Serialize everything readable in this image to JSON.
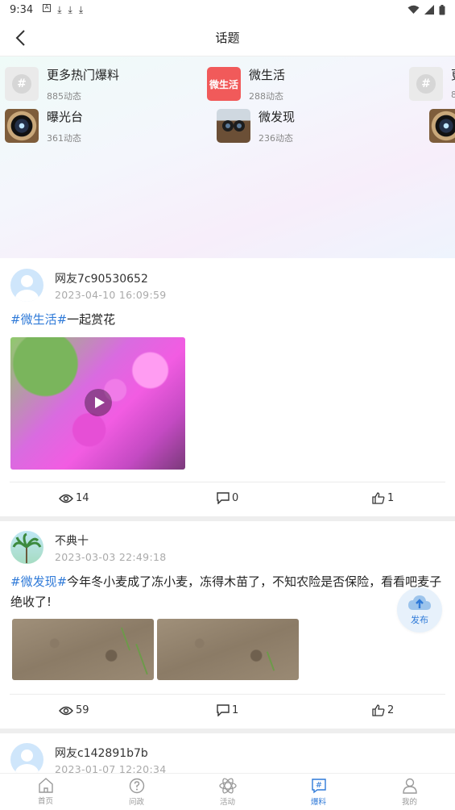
{
  "status_bar": {
    "time": "9:34",
    "icons": [
      "notification-a-icon",
      "download-icon",
      "download-icon",
      "download-icon"
    ]
  },
  "header": {
    "title": "话题",
    "back_icon": "chevron-left-icon"
  },
  "topics": [
    {
      "name": "更多热门爆料",
      "count": "885动态",
      "icon": "hash-icon"
    },
    {
      "name": "微生活",
      "count": "288动态",
      "icon": "weishenghuo-logo-icon",
      "icon_text": "微生活"
    },
    {
      "name": "曝光台",
      "count": "361动态",
      "icon": "camera-lens-icon"
    },
    {
      "name": "微发现",
      "count": "236动态",
      "icon": "binoculars-icon"
    },
    {
      "name": "更",
      "count": "8",
      "icon": "hash-icon"
    }
  ],
  "posts": [
    {
      "user": "网友7c90530652",
      "time": "2023-04-10  16:09:59",
      "tag": "#微生活#",
      "text": "一起赏花",
      "views": "14",
      "comments": "0",
      "likes": "1"
    },
    {
      "user": "不典十",
      "time": "2023-03-03  22:49:18",
      "tag": "#微发现#",
      "text": "今年冬小麦成了冻小麦，冻得木苗了，不知农险是否保险，看看吧麦子绝收了!",
      "views": "59",
      "comments": "1",
      "likes": "2"
    },
    {
      "user": "网友c142891b7b",
      "time": "2023-01-07  12:20:34"
    }
  ],
  "fab": {
    "label": "发布"
  },
  "nav": [
    {
      "label": "首页",
      "icon": "home-icon"
    },
    {
      "label": "问政",
      "icon": "question-icon"
    },
    {
      "label": "活动",
      "icon": "activity-atom-icon"
    },
    {
      "label": "爆料",
      "icon": "hash-tag-icon",
      "active": true
    },
    {
      "label": "我的",
      "icon": "user-icon"
    }
  ],
  "colors": {
    "accent": "#2f7ad8",
    "text": "#222222",
    "muted": "#aaaaaa",
    "divider": "#eeeeee"
  }
}
